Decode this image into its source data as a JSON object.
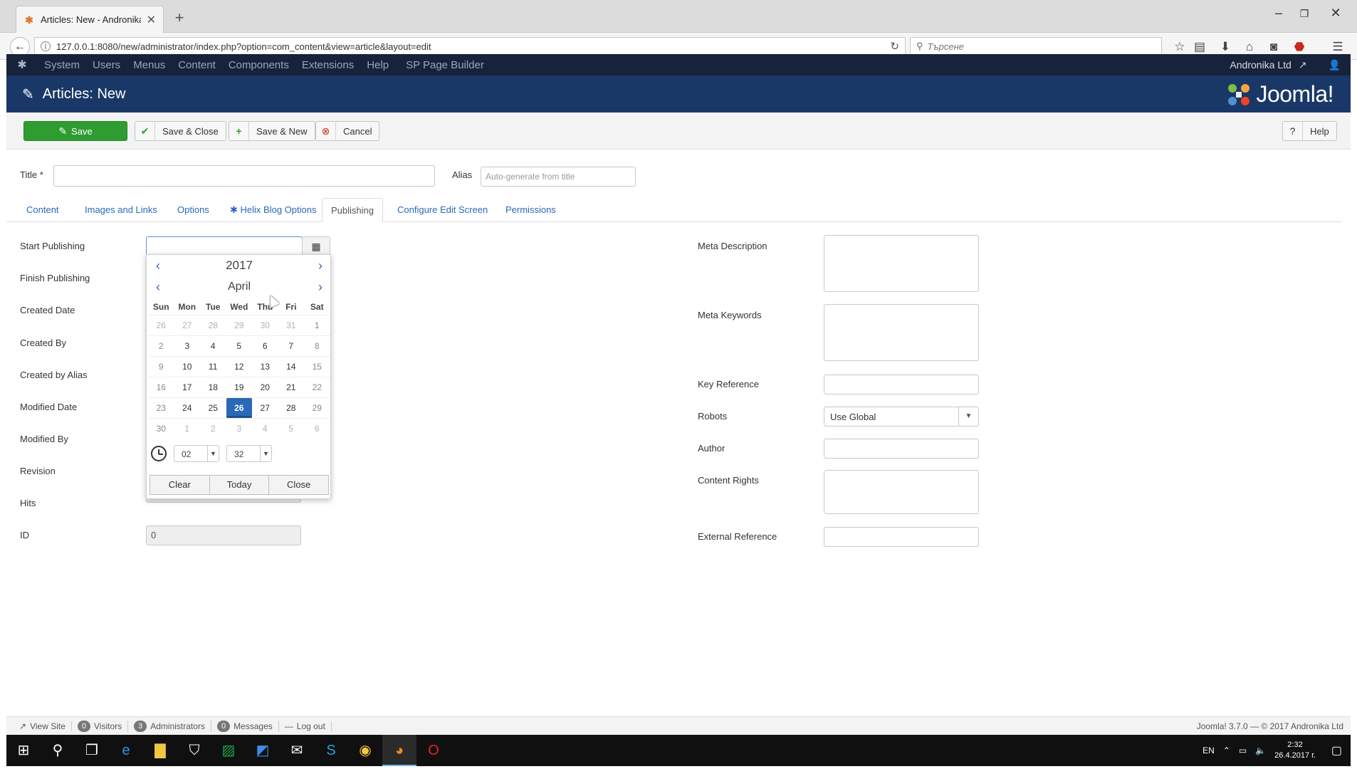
{
  "browser": {
    "tab_title": "Articles: New - Andronika ...",
    "url": "127.0.0.1:8080/new/administrator/index.php?option=com_content&view=article&layout=edit",
    "search_placeholder": "Търсене"
  },
  "joomla": {
    "menu": [
      "System",
      "Users",
      "Menus",
      "Content",
      "Components",
      "Extensions",
      "Help",
      "SP Page Builder"
    ],
    "site_name": "Andronika Ltd",
    "page_title": "Articles: New",
    "brand": "Joomla!",
    "toolbar": {
      "save": "Save",
      "save_close": "Save & Close",
      "save_new": "Save & New",
      "cancel": "Cancel",
      "help": "Help"
    }
  },
  "form": {
    "title_label": "Title *",
    "alias_label": "Alias",
    "alias_placeholder": "Auto-generate from title",
    "tabs": [
      "Content",
      "Images and Links",
      "Options",
      "Helix Blog Options",
      "Publishing",
      "Configure Edit Screen",
      "Permissions"
    ],
    "active_tab": "Publishing",
    "left_fields": {
      "start_publishing": "Start Publishing",
      "finish_publishing": "Finish Publishing",
      "created_date": "Created Date",
      "created_by": "Created By",
      "created_by_alias": "Created by Alias",
      "modified_date": "Modified Date",
      "modified_by": "Modified By",
      "revision": "Revision",
      "hits": "Hits",
      "id": "ID",
      "id_value": "0"
    },
    "right_fields": {
      "meta_description": "Meta Description",
      "meta_keywords": "Meta Keywords",
      "key_reference": "Key Reference",
      "robots": "Robots",
      "robots_value": "Use Global",
      "author": "Author",
      "content_rights": "Content Rights",
      "external_reference": "External Reference"
    }
  },
  "calendar": {
    "year": "2017",
    "month": "April",
    "prev": "‹",
    "next": "›",
    "days_of_week": [
      "Sun",
      "Mon",
      "Tue",
      "Wed",
      "Thu",
      "Fri",
      "Sat"
    ],
    "weeks": [
      [
        "26",
        "27",
        "28",
        "29",
        "30",
        "31",
        "1"
      ],
      [
        "2",
        "3",
        "4",
        "5",
        "6",
        "7",
        "8"
      ],
      [
        "9",
        "10",
        "11",
        "12",
        "13",
        "14",
        "15"
      ],
      [
        "16",
        "17",
        "18",
        "19",
        "20",
        "21",
        "22"
      ],
      [
        "23",
        "24",
        "25",
        "26",
        "27",
        "28",
        "29"
      ],
      [
        "30",
        "1",
        "2",
        "3",
        "4",
        "5",
        "6"
      ]
    ],
    "selected_day": "26",
    "hour": "02",
    "minute": "32",
    "buttons": {
      "clear": "Clear",
      "today": "Today",
      "close": "Close"
    }
  },
  "status": {
    "view_site": "View Site",
    "visitors_count": "0",
    "visitors": "Visitors",
    "admins_count": "3",
    "admins": "Administrators",
    "messages_count": "0",
    "messages": "Messages",
    "logout": "Log out",
    "version": "Joomla! 3.7.0 — © 2017 Andronika Ltd"
  },
  "taskbar": {
    "lang": "EN",
    "time": "2:32",
    "date": "26.4.2017 г."
  },
  "colors": {
    "menubar": "#17233a",
    "titlebar": "#1a3867",
    "save_green": "#2f9c32",
    "link_blue": "#2a69b8"
  }
}
